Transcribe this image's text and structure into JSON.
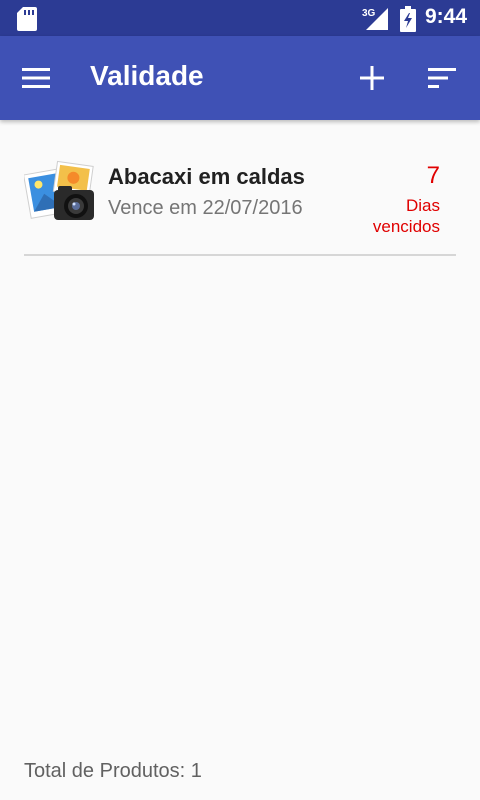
{
  "status_bar": {
    "time": "9:44",
    "network_label": "3G",
    "icons": [
      "sd-card-icon",
      "signal-icon",
      "battery-charging-icon"
    ]
  },
  "app_bar": {
    "title": "Validade",
    "icons": [
      "menu-icon",
      "add-icon",
      "sort-icon"
    ],
    "color": "#3f51b5"
  },
  "products": [
    {
      "name": "Abacaxi em caldas",
      "expiry_text": "Vence em 22/07/2016",
      "days_count": "7",
      "days_label": "Dias vencidos",
      "icon": "photo-camera-icon",
      "status_color": "#e00000"
    }
  ],
  "footer": {
    "total_label": "Total de Produtos: 1"
  }
}
